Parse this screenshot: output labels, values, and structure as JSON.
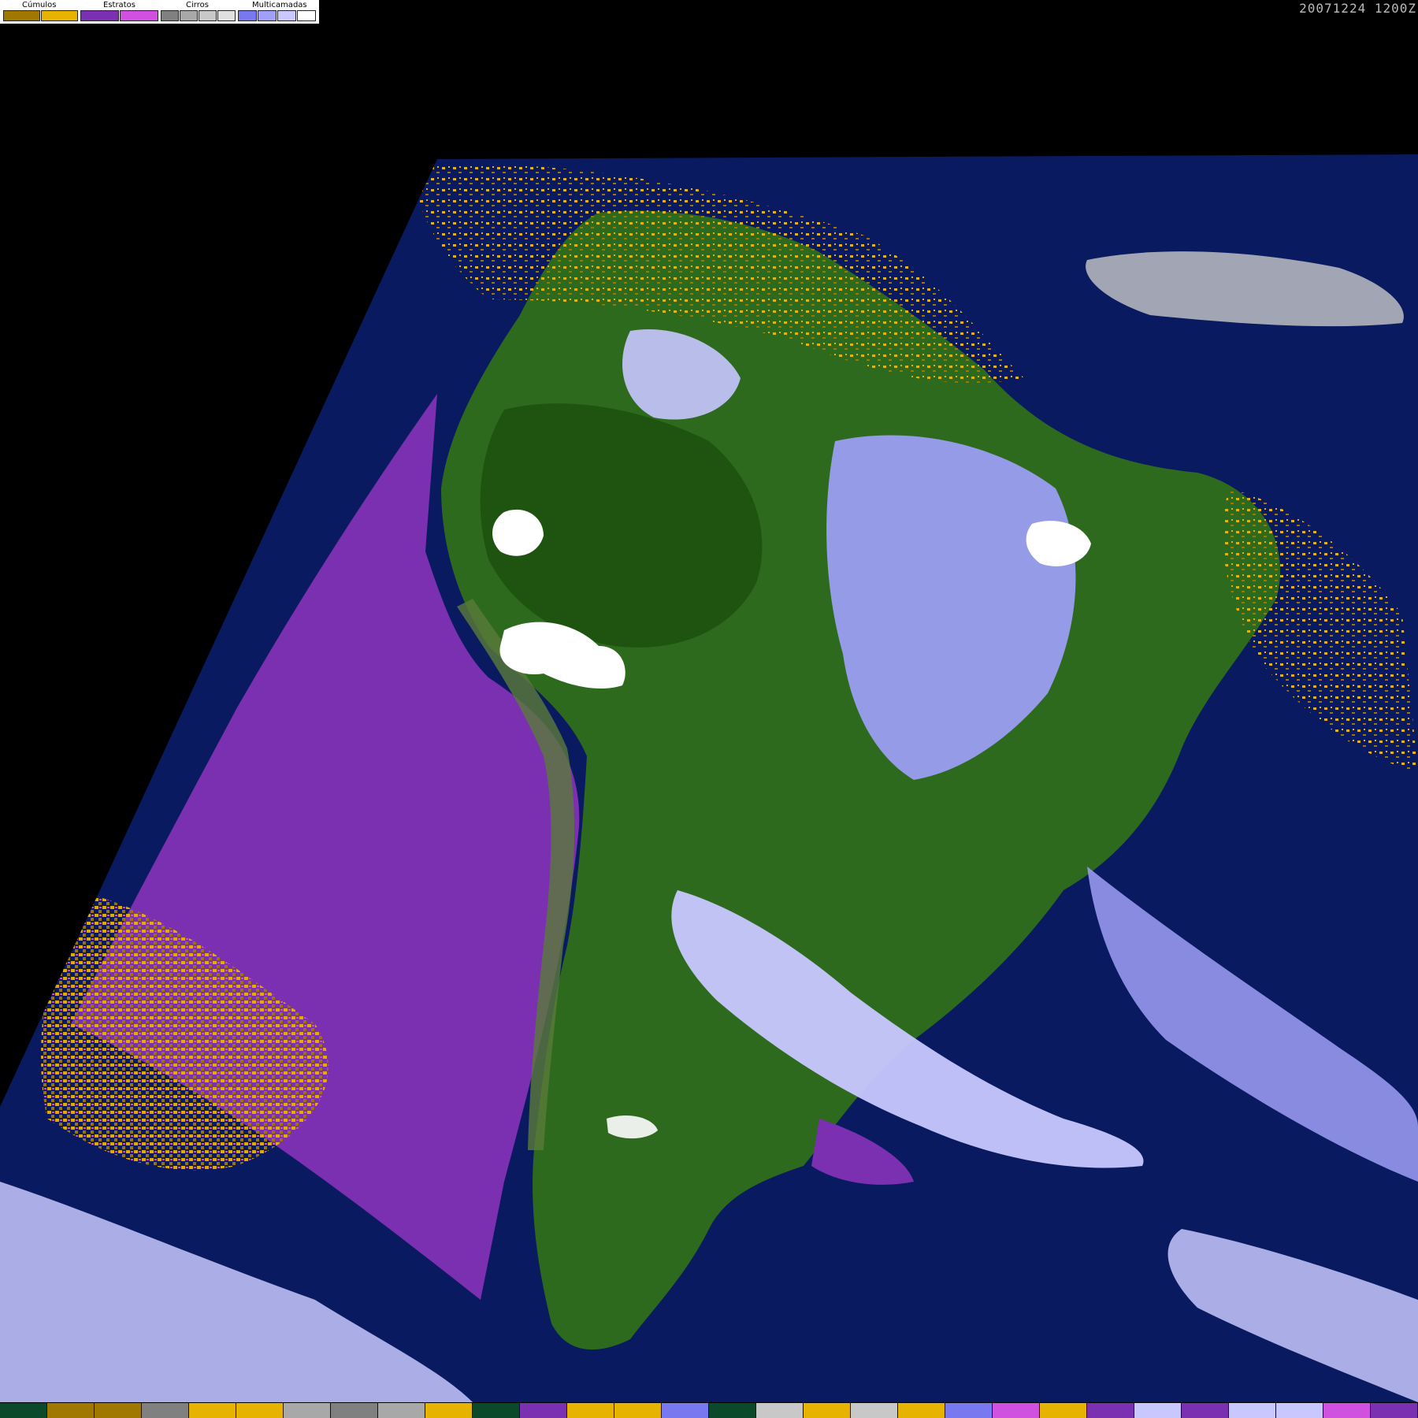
{
  "timestamp": "20071224 1200Z",
  "legend": {
    "groups": [
      {
        "label": "Cúmulos",
        "swatches": [
          "#a07800",
          "#e6b400"
        ]
      },
      {
        "label": "Estratos",
        "swatches": [
          "#7a30b0",
          "#d050e0"
        ]
      },
      {
        "label": "Cirros",
        "swatches": [
          "#808080",
          "#a8a8a8",
          "#c8c8c8",
          "#e0e0e0"
        ]
      },
      {
        "label": "Multicamadas",
        "swatches": [
          "#7878f0",
          "#a0a0f8",
          "#c8c8ff",
          "#ffffff"
        ]
      }
    ]
  },
  "colors": {
    "background": "#000000",
    "ocean": "#0a1a60",
    "land": "#2e6a1e",
    "forest": "#1f5410",
    "stratus": "#7a30b0",
    "stratus_light": "#d050e0",
    "cumulus": "#e6b400",
    "cumulus_dark": "#a07800",
    "multilayer": "#a0a0f8",
    "multilayer_light": "#c8c8ff",
    "cirrus": "#c8c8c8"
  },
  "palette_bar": [
    "#0a4a2a",
    "#a07800",
    "#a07800",
    "#808080",
    "#e6b400",
    "#e6b400",
    "#a8a8a8",
    "#808080",
    "#a8a8a8",
    "#e6b400",
    "#0a4a2a",
    "#7a30b0",
    "#e6b400",
    "#e6b400",
    "#7878f0",
    "#0a4a2a",
    "#c8c8c8",
    "#e6b400",
    "#c8c8c8",
    "#e6b400",
    "#7878f0",
    "#d050e0",
    "#e6b400",
    "#7a30b0",
    "#c8c8ff",
    "#7a30b0",
    "#c8c8ff",
    "#c8c8ff",
    "#d050e0",
    "#7a30b0"
  ]
}
